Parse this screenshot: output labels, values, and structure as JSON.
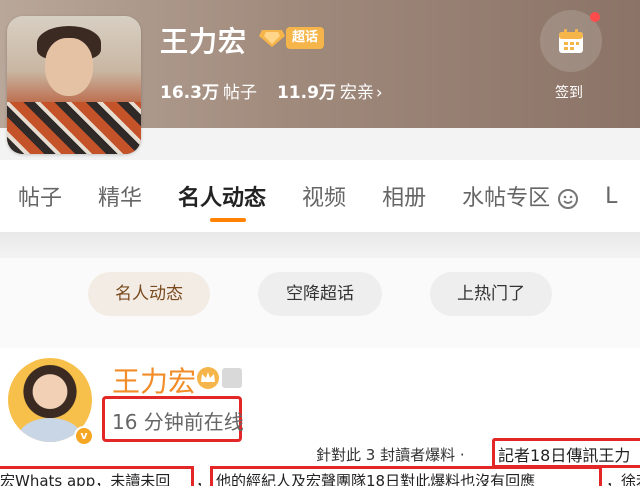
{
  "header": {
    "title": "王力宏",
    "badge_label": "超话",
    "posts_count": "16.3万",
    "posts_label": "帖子",
    "fans_count": "11.9万",
    "fans_label": "宏亲",
    "fans_chevron": "›",
    "checkin_label": "签到",
    "icons": [
      "diamond-icon",
      "calendar-icon"
    ],
    "accent_badge_color": "#f6b54a"
  },
  "tabs": [
    {
      "label": "帖子"
    },
    {
      "label": "精华"
    },
    {
      "label": "名人动态"
    },
    {
      "label": "视频"
    },
    {
      "label": "相册"
    },
    {
      "label": "水帖专区"
    },
    {
      "label": "L"
    }
  ],
  "tab_active_color": "#ff8200",
  "filters": [
    {
      "label": "名人动态"
    },
    {
      "label": "空降超话"
    },
    {
      "label": "上热门了"
    }
  ],
  "post": {
    "author": "王力宏",
    "online_status": "16 分钟前在线",
    "vbadge": "v",
    "news_line_1": "針對此 3 封讀者爆料 ·",
    "news_reporter": "記者18日傳訊王力",
    "news_line_2_a": "宏Whats app，未讀未回",
    "news_line_2_sep": "，",
    "news_line_2_b": "他的經紀人及宏聲團隊18日對此爆料也沒有回應",
    "news_line_2_c": "，徐若",
    "highlight_color": "#e32626",
    "name_color": "#f28c28"
  }
}
